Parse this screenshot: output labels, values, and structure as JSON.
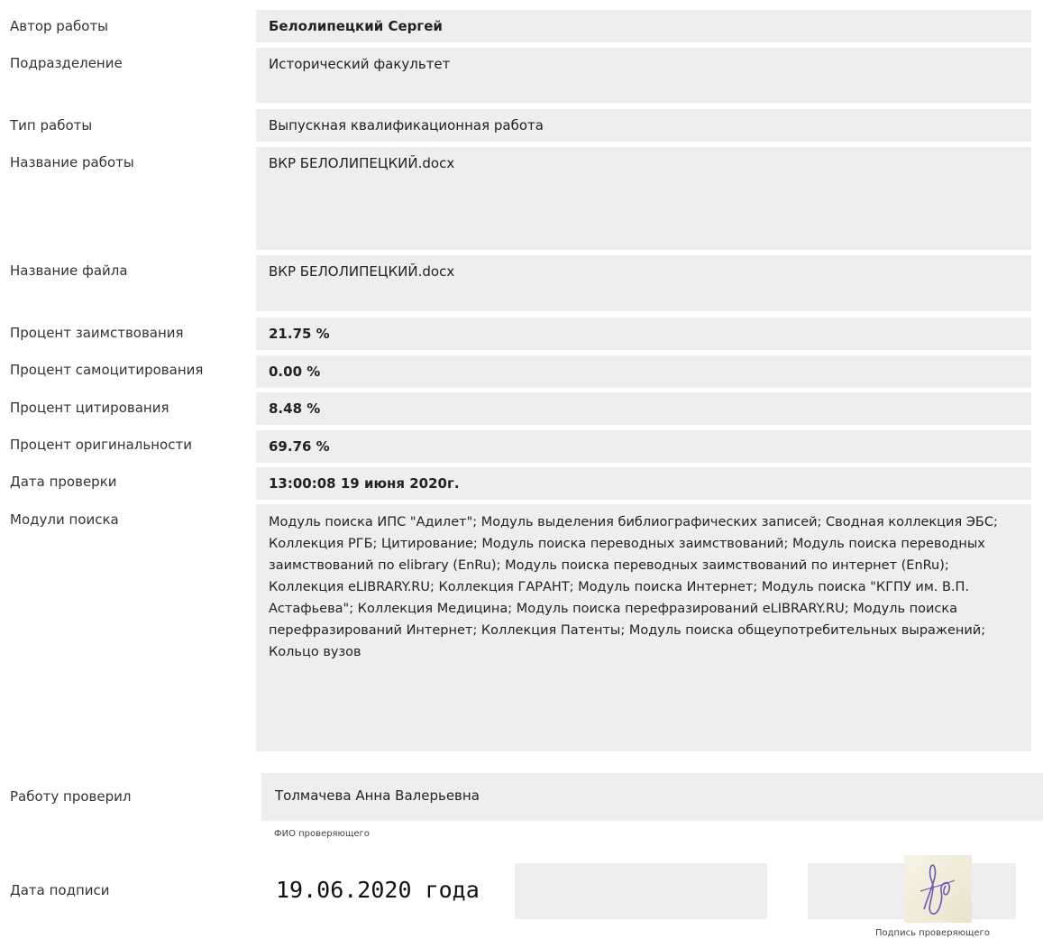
{
  "fields": [
    {
      "label": "Автор работы",
      "value": "Белолипецкий Сергей"
    },
    {
      "label": "Подразделение",
      "value": "Исторический факультет"
    },
    {
      "label": "Тип работы",
      "value": "Выпускная квалификационная работа"
    },
    {
      "label": "Название работы",
      "value": "ВКР БЕЛОЛИПЕЦКИЙ.docx"
    },
    {
      "label": "Название файла",
      "value": "ВКР БЕЛОЛИПЕЦКИЙ.docx"
    },
    {
      "label": "Процент заимствования",
      "value": "21.75 %"
    },
    {
      "label": "Процент самоцитирования",
      "value": "0.00 %"
    },
    {
      "label": "Процент цитирования",
      "value": "8.48 %"
    },
    {
      "label": "Процент оригинальности",
      "value": "69.76 %"
    },
    {
      "label": "Дата проверки",
      "value": "13:00:08 19 июня 2020г."
    },
    {
      "label": "Модули поиска",
      "value": "Модуль поиска ИПС \"Адилет\"; Модуль выделения библиографических записей; Сводная коллекция ЭБС; Коллекция РГБ; Цитирование; Модуль поиска переводных заимствований; Модуль поиска переводных заимствований по elibrary (EnRu); Модуль поиска переводных заимствований по интернет (EnRu); Коллекция eLIBRARY.RU; Коллекция ГАРАНТ; Модуль поиска Интернет; Модуль поиска \"КГПУ им. В.П. Астафьева\"; Коллекция Медицина; Модуль поиска перефразирований eLIBRARY.RU; Модуль поиска перефразирований Интернет; Коллекция Патенты; Модуль поиска общеупотребительных выражений; Кольцо вузов"
    }
  ],
  "checked_by": {
    "label": "Работу проверил",
    "value": "Толмачева Анна Валерьевна",
    "caption": "ФИО проверяющего"
  },
  "sign_date": {
    "label": "Дата подписи",
    "value": "19.06.2020 года",
    "caption": "Подпись проверяющего"
  }
}
